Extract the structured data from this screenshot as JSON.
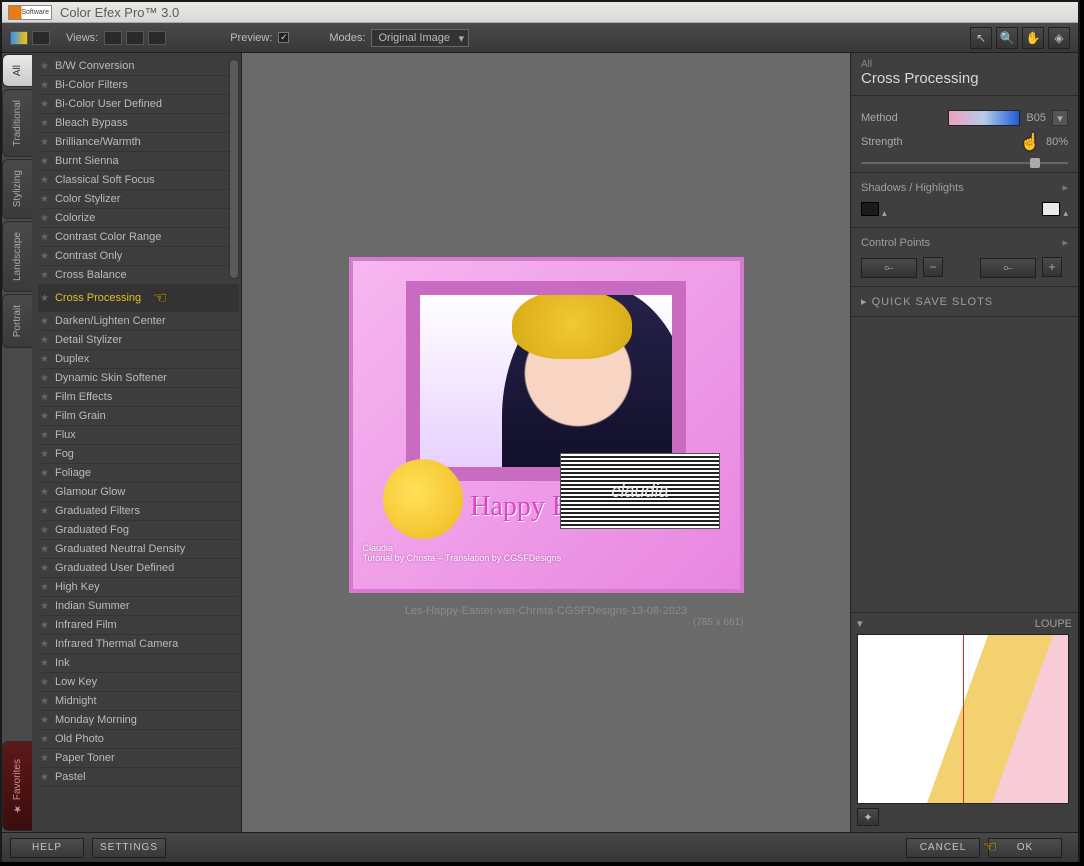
{
  "app": {
    "title": "Color Efex Pro™ 3.0",
    "logo_text": "Software"
  },
  "toolbar": {
    "views_label": "Views:",
    "preview_label": "Preview:",
    "modes_label": "Modes:",
    "mode_selected": "Original Image"
  },
  "tabs": {
    "items": [
      {
        "label": "All",
        "active": true
      },
      {
        "label": "Traditional",
        "active": false
      },
      {
        "label": "Stylizing",
        "active": false
      },
      {
        "label": "Landscape",
        "active": false
      },
      {
        "label": "Portrait",
        "active": false
      }
    ],
    "favorites_label": "Favorites"
  },
  "filters": {
    "items": [
      "B/W Conversion",
      "Bi-Color Filters",
      "Bi-Color User Defined",
      "Bleach Bypass",
      "Brilliance/Warmth",
      "Burnt Sienna",
      "Classical Soft Focus",
      "Color Stylizer",
      "Colorize",
      "Contrast Color Range",
      "Contrast Only",
      "Cross Balance",
      "Cross Processing",
      "Darken/Lighten Center",
      "Detail Stylizer",
      "Duplex",
      "Dynamic Skin Softener",
      "Film Effects",
      "Film Grain",
      "Flux",
      "Fog",
      "Foliage",
      "Glamour Glow",
      "Graduated Filters",
      "Graduated Fog",
      "Graduated Neutral Density",
      "Graduated User Defined",
      "High Key",
      "Indian Summer",
      "Infrared Film",
      "Infrared Thermal Camera",
      "Ink",
      "Low Key",
      "Midnight",
      "Monday Morning",
      "Old Photo",
      "Paper Toner",
      "Pastel"
    ],
    "selected": "Cross Processing"
  },
  "preview": {
    "easter_title": "Happy Easter",
    "credit1": "Claudia",
    "credit2": "Tutorial by Christa – Translation by CGSFDesigns",
    "caption": "Les-Happy-Easter-van-Christa-CGSFDesigns-13-08-2023",
    "dimensions": "(785 x 661)"
  },
  "watermark": {
    "text": "claudia"
  },
  "right": {
    "group": "All",
    "filter_name": "Cross Processing",
    "method_label": "Method",
    "method_value": "B05",
    "strength_label": "Strength",
    "strength_value": "80%",
    "shadows_label": "Shadows / Highlights",
    "control_points_label": "Control Points",
    "quick_save_label": "QUICK SAVE SLOTS",
    "loupe_label": "LOUPE"
  },
  "bottom": {
    "help": "HELP",
    "settings": "SETTINGS",
    "cancel": "CANCEL",
    "ok": "OK"
  }
}
